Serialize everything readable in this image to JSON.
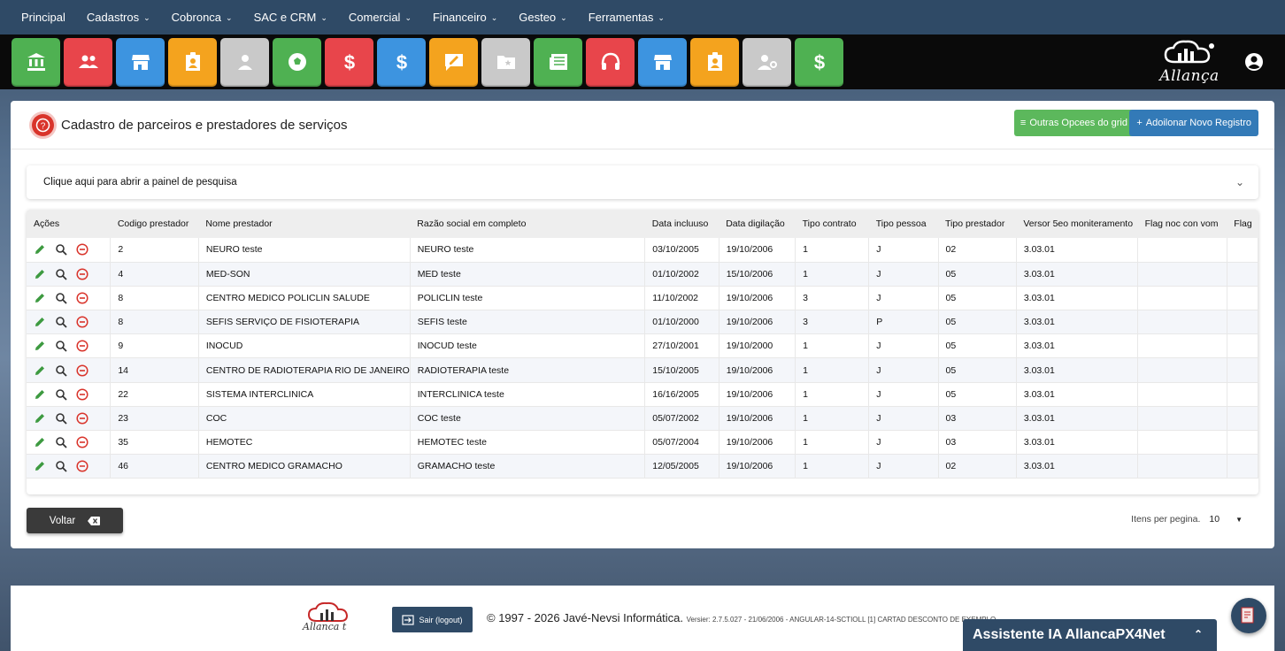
{
  "nav": {
    "items": [
      {
        "label": "Principal",
        "dropdown": false
      },
      {
        "label": "Cadastros",
        "dropdown": true
      },
      {
        "label": "Cobronca",
        "dropdown": true
      },
      {
        "label": "SAC e CRM",
        "dropdown": true
      },
      {
        "label": "Comercial",
        "dropdown": true
      },
      {
        "label": "Financeiro",
        "dropdown": true
      },
      {
        "label": "Gesteo",
        "dropdown": true
      },
      {
        "label": "Ferramentas",
        "dropdown": true
      }
    ]
  },
  "quickbar": {
    "tiles": [
      {
        "icon": "bank-icon",
        "color": "#4fb152"
      },
      {
        "icon": "users-icon",
        "color": "#e8454b"
      },
      {
        "icon": "store-icon",
        "color": "#3d94e0"
      },
      {
        "icon": "id-badge-icon",
        "color": "#f4a31e"
      },
      {
        "icon": "person-icon",
        "color": "#c9c9c9"
      },
      {
        "icon": "soccer-ball-icon",
        "color": "#4fb152"
      },
      {
        "icon": "dollar-icon",
        "color": "#e8454b"
      },
      {
        "icon": "dollar-icon",
        "color": "#3d94e0"
      },
      {
        "icon": "chat-edit-icon",
        "color": "#f4a31e"
      },
      {
        "icon": "folder-star-icon",
        "color": "#c9c9c9"
      },
      {
        "icon": "newspaper-icon",
        "color": "#4fb152"
      },
      {
        "icon": "headset-icon",
        "color": "#e8454b"
      },
      {
        "icon": "store-icon",
        "color": "#3d94e0"
      },
      {
        "icon": "id-badge-icon",
        "color": "#f4a31e"
      },
      {
        "icon": "user-settings-icon",
        "color": "#c9c9c9"
      },
      {
        "icon": "dollar-icon",
        "color": "#4fb152"
      }
    ],
    "brand": "Allança"
  },
  "page": {
    "title": "Cadastro de parceiros e prestadores de serviços",
    "btn_grid": "Outras Opcees do grid",
    "btn_add": "Adoilonar Novo Registro",
    "search_toggle": "Clique aqui para abrir a painel de pesquisa"
  },
  "grid": {
    "columns": [
      "Ações",
      "Codigo prestador",
      "Nome prestador",
      "Razão social em completo",
      "Data incluuso",
      "Data digilação",
      "Tipo contrato",
      "Tipo pessoa",
      "Tipo prestador",
      "Versor 5eo moniteramento",
      "Flag noc con vom",
      "Flag"
    ],
    "rows": [
      [
        "2",
        "NEURO teste",
        "NEURO teste",
        "03/10/2005",
        "19/10/2006",
        "1",
        "J",
        "02",
        "3.03.01",
        "",
        ""
      ],
      [
        "4",
        "MED-SON",
        "MED teste",
        "01/10/2002",
        "15/10/2006",
        "1",
        "J",
        "05",
        "3.03.01",
        "",
        ""
      ],
      [
        "8",
        "CENTRO MEDICO POLICLIN SALUDE",
        "POLICLIN teste",
        "11/10/2002",
        "19/10/2006",
        "3",
        "J",
        "05",
        "3.03.01",
        "",
        ""
      ],
      [
        "8",
        "SEFIS SERVIÇO DE FISIOTERAPIA",
        "SEFIS teste",
        "01/10/2000",
        "19/10/2006",
        "3",
        "P",
        "05",
        "3.03.01",
        "",
        ""
      ],
      [
        "9",
        "INOCUD",
        "INOCUD teste",
        "27/10/2001",
        "19/10/2000",
        "1",
        "J",
        "05",
        "3.03.01",
        "",
        ""
      ],
      [
        "14",
        "CENTRO DE RADIOTERAPIA RIO DE JANEIRO",
        "RADIOTERAPIA teste",
        "15/10/2005",
        "19/10/2006",
        "1",
        "J",
        "05",
        "3.03.01",
        "",
        ""
      ],
      [
        "22",
        "SISTEMA INTERCLINICA",
        "INTERCLINICA teste",
        "16/16/2005",
        "19/10/2006",
        "1",
        "J",
        "05",
        "3.03.01",
        "",
        ""
      ],
      [
        "23",
        "COC",
        "COC teste",
        "05/07/2002",
        "19/10/2006",
        "1",
        "J",
        "03",
        "3.03.01",
        "",
        ""
      ],
      [
        "35",
        "HEMOTEC",
        "HEMOTEC teste",
        "05/07/2004",
        "19/10/2006",
        "1",
        "J",
        "03",
        "3.03.01",
        "",
        ""
      ],
      [
        "46",
        "CENTRO MEDICO GRAMACHO",
        "GRAMACHO teste",
        "12/05/2005",
        "19/10/2006",
        "1",
        "J",
        "02",
        "3.03.01",
        "",
        ""
      ]
    ]
  },
  "footer_controls": {
    "voltar": "Voltar",
    "items_per_page_label": "Itens per pegina.",
    "items_per_page_value": "10"
  },
  "footer": {
    "logo_text": "Allanca t",
    "logout": "Sair (logout)",
    "copyright": "© 1997 - 2026 Javé-Nevsi Informática.",
    "version": "Versier: 2.7.5.027 - 21/06/2006 - ANGULAR-14-SCTIOLL [1] CARTAD DESCONTO DE EXEMPLO"
  },
  "assistant": {
    "label": "Assistente IA AllancaPX4Net"
  }
}
